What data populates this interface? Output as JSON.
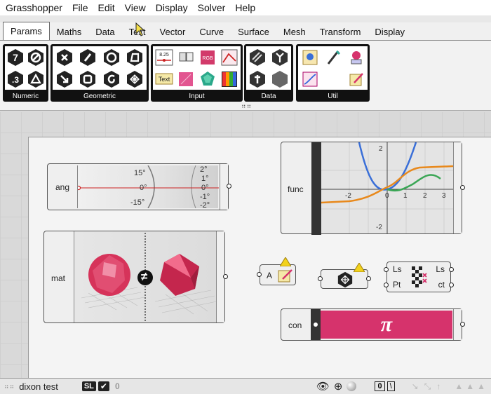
{
  "menu": [
    "Grasshopper",
    "File",
    "Edit",
    "View",
    "Display",
    "Solver",
    "Help"
  ],
  "tabs": [
    {
      "label": "Params",
      "active": true
    },
    {
      "label": "Maths"
    },
    {
      "label": "Data"
    },
    {
      "label": "Text"
    },
    {
      "label": "Vector"
    },
    {
      "label": "Curve"
    },
    {
      "label": "Surface"
    },
    {
      "label": "Mesh"
    },
    {
      "label": "Transform"
    },
    {
      "label": "Display"
    }
  ],
  "ribbon": {
    "groups": [
      "Numeric",
      "Geometric",
      "Input",
      "Data",
      "Util"
    ],
    "numeric_glyphs": [
      "7",
      ".3"
    ],
    "input_labels": [
      "8.25",
      "RGB",
      "Text"
    ]
  },
  "components": {
    "ang": {
      "name": "ang",
      "ticks_left": [
        "15°",
        "0°",
        "-15°"
      ],
      "ticks_right": [
        "2°",
        "1°",
        "0°",
        "-1°",
        "-2°"
      ]
    },
    "func": {
      "name": "func",
      "x_ticks": [
        "-2",
        "1",
        "2",
        "3"
      ],
      "zero_label": "0",
      "y_ticks": [
        "2",
        "-2"
      ]
    },
    "mat": {
      "name": "mat",
      "operator": "≠"
    },
    "panel_a": {
      "label": "A"
    },
    "list": {
      "in": [
        "Ls",
        "Pt"
      ],
      "out": [
        "Ls",
        "ct"
      ]
    },
    "con": {
      "name": "con",
      "symbol": "π"
    }
  },
  "status": {
    "left_text": "dixon test",
    "badge_sl": "SL",
    "count": "0",
    "zero_label": "0"
  },
  "colors": {
    "accent_pink": "#d6336c",
    "curve_blue": "#3a6fd8",
    "curve_orange": "#e8891c",
    "curve_green": "#3aa655",
    "dark": "#1a1a1a"
  }
}
